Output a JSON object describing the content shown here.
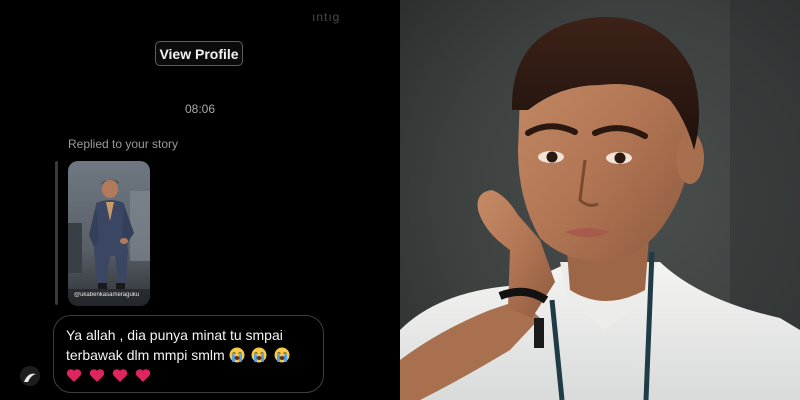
{
  "dm": {
    "header_faint": "ıntıg",
    "view_profile_label": "View Profile",
    "timestamp": "08:06",
    "replied_label": "Replied to your story",
    "story_caption": "@ukabenkasameraguku",
    "message": {
      "line1": "Ya allah , dia punya minat tu smpai",
      "line2": "terbawak dlm mmpi smlm",
      "emojis_line2": [
        "loudly-crying-face",
        "loudly-crying-face",
        "loudly-crying-face"
      ],
      "emojis_line3": [
        "red-heart",
        "red-heart",
        "red-heart",
        "red-heart"
      ]
    }
  },
  "photo": {
    "subject": "portrait-man-hand-on-cheek"
  },
  "colors": {
    "background": "#000000",
    "bubble_border": "#3e3e3e",
    "heart": "#e0245e",
    "emoji_face": "#f7c948",
    "tears": "#4fa3e8"
  }
}
